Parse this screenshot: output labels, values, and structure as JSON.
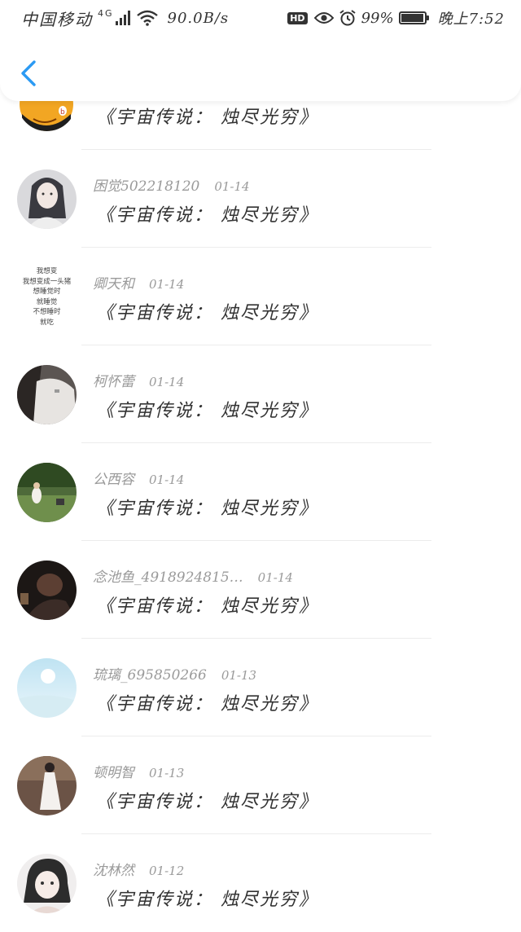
{
  "status_bar": {
    "carrier": "中国移动",
    "network_type": "4G",
    "network_sub": "G",
    "speed": "90.0B/s",
    "hd": "HD",
    "battery_percent": "99%",
    "battery_level": 0.99,
    "time": "晚上7:52"
  },
  "nav": {
    "back_icon": "chevron-left-icon",
    "accent_color": "#2b9af3"
  },
  "comments": [
    {
      "username": "",
      "date": "",
      "content": "《宇宙传说： 烛尽光穷》",
      "avatar": "cartoon-avatar-partial"
    },
    {
      "username": "困觉502218120",
      "date": "01-14",
      "content": "《宇宙传说： 烛尽光穷》",
      "avatar": "girl-portrait-avatar"
    },
    {
      "username": "卿天和",
      "date": "01-14",
      "content": "《宇宙传说： 烛尽光穷》",
      "avatar": "text-avatar",
      "avatar_text": [
        "我想变",
        "我想变成一头猪",
        "想睡觉时",
        "就睡觉",
        "不想睡时",
        "就吃"
      ]
    },
    {
      "username": "柯怀蕾",
      "date": "01-14",
      "content": "《宇宙传说： 烛尽光穷》",
      "avatar": "person-avatar"
    },
    {
      "username": "公西容",
      "date": "01-14",
      "content": "《宇宙传说： 烛尽光穷》",
      "avatar": "garden-avatar"
    },
    {
      "username": "念池鱼_4918924815…",
      "date": "01-14",
      "content": "《宇宙传说： 烛尽光穷》",
      "avatar": "dark-photo-avatar"
    },
    {
      "username": "琉璃_695850266",
      "date": "01-13",
      "content": "《宇宙传说： 烛尽光穷》",
      "avatar": "sky-avatar"
    },
    {
      "username": "顿明智",
      "date": "01-13",
      "content": "《宇宙传说： 烛尽光穷》",
      "avatar": "girl-dress-avatar"
    },
    {
      "username": "沈林然",
      "date": "01-12",
      "content": "《宇宙传说： 烛尽光穷》",
      "avatar": "anime-girl-avatar"
    }
  ]
}
